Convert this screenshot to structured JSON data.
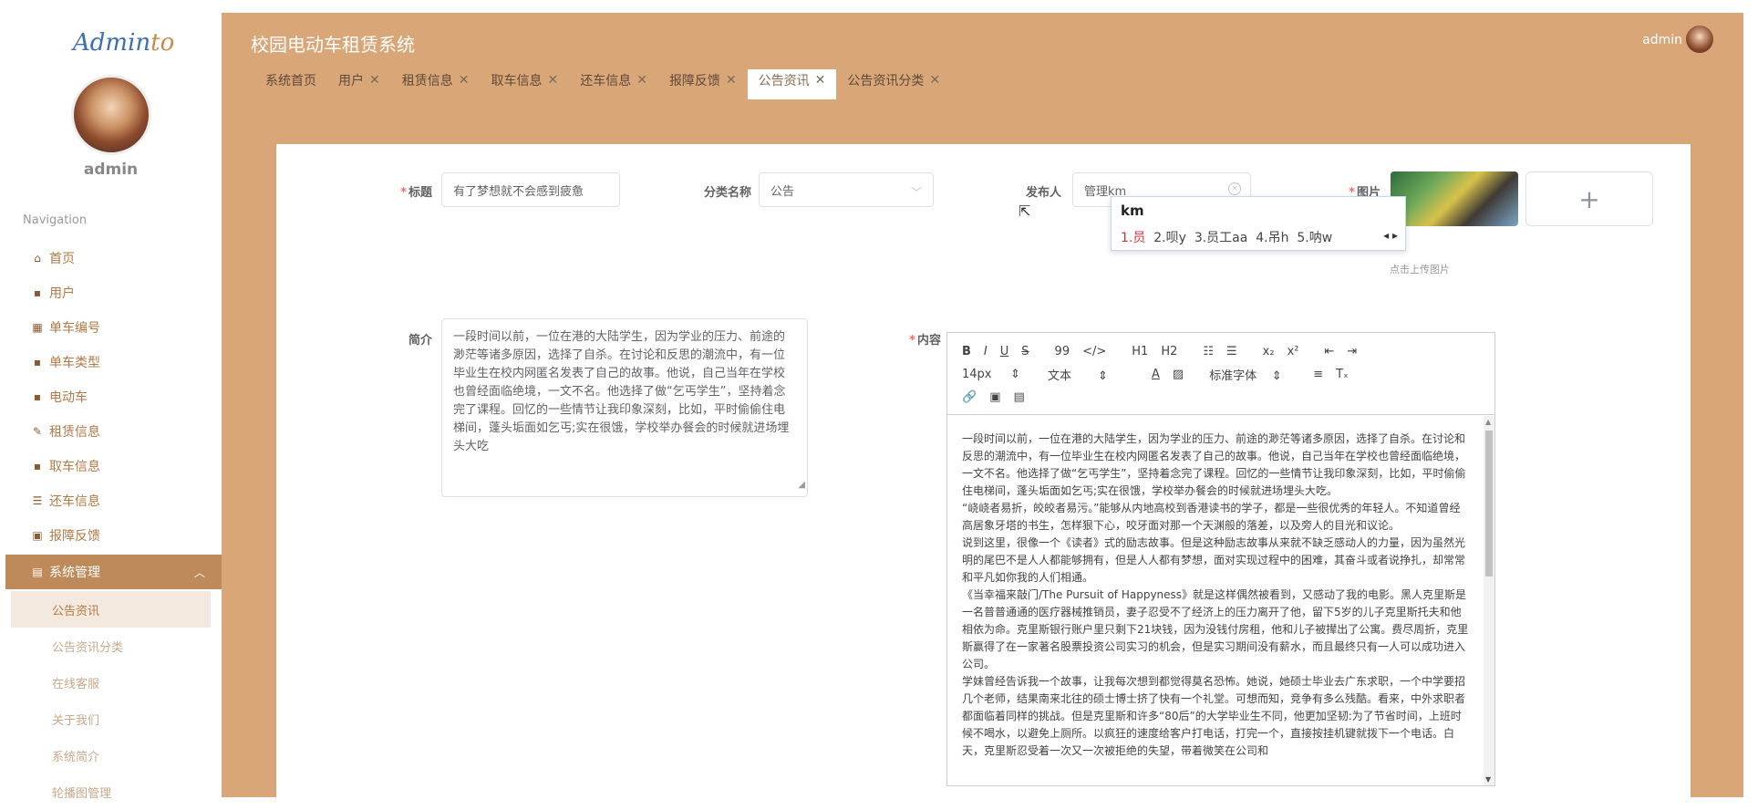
{
  "app": {
    "title": "校园电动车租赁系统",
    "logo_main": "Admin",
    "logo_accent": "to",
    "user": "admin"
  },
  "sidebar": {
    "username": "admin",
    "nav_title": "Navigation",
    "items": [
      {
        "label": "首页",
        "icon": "home-icon"
      },
      {
        "label": "用户",
        "icon": "grid-icon"
      },
      {
        "label": "单车编号",
        "icon": "grid-icon"
      },
      {
        "label": "单车类型",
        "icon": "grid-icon"
      },
      {
        "label": "电动车",
        "icon": "grid-icon"
      },
      {
        "label": "租赁信息",
        "icon": "edit-icon"
      },
      {
        "label": "取车信息",
        "icon": "grid-icon"
      },
      {
        "label": "还车信息",
        "icon": "list-icon"
      },
      {
        "label": "报障反馈",
        "icon": "chart-icon"
      },
      {
        "label": "系统管理",
        "icon": "doc-icon"
      }
    ],
    "sub_items": [
      "公告资讯",
      "公告资讯分类",
      "在线客服",
      "关于我们",
      "系统简介",
      "轮播图管理"
    ]
  },
  "tabs": [
    {
      "label": "系统首页",
      "closable": false
    },
    {
      "label": "用户",
      "closable": true
    },
    {
      "label": "租赁信息",
      "closable": true
    },
    {
      "label": "取车信息",
      "closable": true
    },
    {
      "label": "还车信息",
      "closable": true
    },
    {
      "label": "报障反馈",
      "closable": true
    },
    {
      "label": "公告资讯",
      "closable": true
    },
    {
      "label": "公告资讯分类",
      "closable": true
    }
  ],
  "form": {
    "title_label": "标题",
    "title_value": "有了梦想就不会感到疲惫",
    "category_label": "分类名称",
    "category_value": "公告",
    "publisher_label": "发布人",
    "publisher_value": "管理km",
    "image_label": "图片",
    "upload_hint": "点击上传图片",
    "summary_label": "简介",
    "summary_value": "一段时间以前，一位在港的大陆学生，因为学业的压力、前途的渺茫等诸多原因，选择了自杀。在讨论和反思的潮流中，有一位毕业生在校内网匿名发表了自己的故事。他说，自己当年在学校也曾经面临绝境，一文不名。他选择了做“乞丐学生”，坚持着念完了课程。回忆的一些情节让我印象深刻，比如，平时偷偷住电梯间，蓬头垢面如乞丐;实在很饿，学校举办餐会的时候就进场埋头大吃",
    "content_label": "内容"
  },
  "ime": {
    "typed": "km",
    "candidates": [
      "1.员",
      "2.呗y",
      "3.员工aa",
      "4.吊h",
      "5.呐w"
    ]
  },
  "editor": {
    "toolbar_row1": [
      "B",
      "I",
      "U",
      "S",
      "99",
      "</>",
      "H1",
      "H2",
      "ol",
      "ul",
      "x₂",
      "x²",
      "indent-",
      "indent+"
    ],
    "font_size": "14px",
    "text_style": "文本",
    "font_family": "标准字体",
    "content_paragraphs": [
      "一段时间以前，一位在港的大陆学生，因为学业的压力、前途的渺茫等诸多原因，选择了自杀。在讨论和反思的潮流中，有一位毕业生在校内网匿名发表了自己的故事。他说，自己当年在学校也曾经面临绝境，一文不名。他选择了做“乞丐学生”，坚持着念完了课程。回忆的一些情节让我印象深刻，比如，平时偷偷住电梯间，蓬头垢面如乞丐;实在很饿，学校举办餐会的时候就进场埋头大吃。",
      "“峣峣者易折，皎皎者易污。”能够从内地高校到香港读书的学子，都是一些很优秀的年轻人。不知道曾经高居象牙塔的书生，怎样狠下心，咬牙面对那一个天渊般的落差，以及旁人的目光和议论。",
      "说到这里，很像一个《读者》式的励志故事。但是这种励志故事从来就不缺乏感动人的力量，因为虽然光明的尾巴不是人人都能够拥有，但是人人都有梦想，面对实现过程中的困难，其奋斗或者说挣扎，却常常和平凡如你我的人们相通。",
      "《当幸福来敲门/The Pursuit of Happyness》就是这样偶然被看到，又感动了我的电影。黑人克里斯是一名普普通通的医疗器械推销员，妻子忍受不了经济上的压力离开了他，留下5岁的儿子克里斯托夫和他相依为命。克里斯银行账户里只剩下21块钱，因为没钱付房租，他和儿子被撵出了公寓。费尽周折，克里斯赢得了在一家著名股票投资公司实习的机会，但是实习期间没有薪水，而且最终只有一人可以成功进入公司。",
      "学妹曾经告诉我一个故事，让我每次想到都觉得莫名恐怖。她说，她硕士毕业去广东求职，一个中学要招几个老师，结果南来北往的硕士博士挤了快有一个礼堂。可想而知，竞争有多么残酷。看来，中外求职者都面临着同样的挑战。但是克里斯和许多“80后”的大学毕业生不同，他更加坚韧:为了节省时间，上班时候不喝水，以避免上厕所。以疯狂的速度给客户打电话，打完一个，直接按挂机键就拨下一个电话。白天，克里斯忍受着一次又一次被拒绝的失望，带着微笑在公司和"
    ]
  },
  "colors": {
    "accent": "#d9a677",
    "sidebar_text": "#b27a46",
    "active_nav": "#bf8a5a",
    "required": "#f56c6c"
  }
}
